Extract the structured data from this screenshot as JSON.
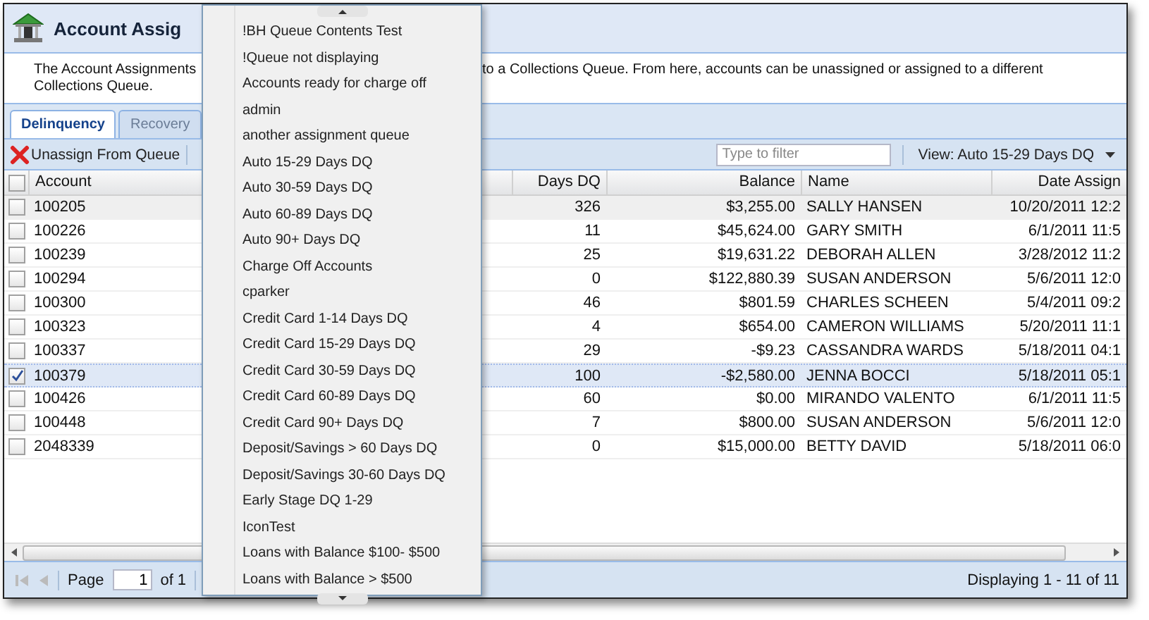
{
  "header": {
    "title": "Account Assig"
  },
  "description": {
    "left": "The Account Assignments",
    "right": "to a Collections Queue. From here, accounts can be unassigned or assigned to a different",
    "line2": "Collections Queue."
  },
  "tabs": [
    {
      "label": "Delinquency",
      "selected": true
    },
    {
      "label": "Recovery",
      "selected": false
    }
  ],
  "toolbar": {
    "unassign_button": "Unassign From Queue",
    "filter": {
      "placeholder": "Type to filter"
    },
    "view_menu": "View: Auto 15-29 Days DQ"
  },
  "table": {
    "all_selected": false,
    "columns": [
      "Account",
      "Days DQ",
      "Balance",
      "Name",
      "Date Assign"
    ],
    "rows": [
      {
        "selected": false,
        "hovered": true,
        "cells": [
          "100205",
          "326",
          "$3,255.00",
          "SALLY HANSEN",
          "10/20/2011 12:2"
        ]
      },
      {
        "selected": false,
        "hovered": false,
        "cells": [
          "100226",
          "11",
          "$45,624.00",
          "GARY SMITH",
          "6/1/2011 11:5"
        ]
      },
      {
        "selected": false,
        "hovered": false,
        "cells": [
          "100239",
          "25",
          "$19,631.22",
          "DEBORAH ALLEN",
          "3/28/2012 11:2"
        ]
      },
      {
        "selected": false,
        "hovered": false,
        "cells": [
          "100294",
          "0",
          "$122,880.39",
          "SUSAN ANDERSON",
          "5/6/2011 12:0"
        ]
      },
      {
        "selected": false,
        "hovered": false,
        "cells": [
          "100300",
          "46",
          "$801.59",
          "CHARLES SCHEEN",
          "5/4/2011 09:2"
        ]
      },
      {
        "selected": false,
        "hovered": false,
        "cells": [
          "100323",
          "4",
          "$654.00",
          "CAMERON WILLIAMS",
          "5/20/2011 11:1"
        ]
      },
      {
        "selected": false,
        "hovered": false,
        "cells": [
          "100337",
          "29",
          "-$9.23",
          "CASSANDRA WARDS",
          "5/18/2011 04:1"
        ]
      },
      {
        "selected": true,
        "hovered": false,
        "cells": [
          "100379",
          "100",
          "-$2,580.00",
          "JENNA BOCCI",
          "5/18/2011 05:1"
        ]
      },
      {
        "selected": false,
        "hovered": false,
        "cells": [
          "100426",
          "60",
          "$0.00",
          "MIRANDO VALENTO",
          "6/1/2011 11:5"
        ]
      },
      {
        "selected": false,
        "hovered": false,
        "cells": [
          "100448",
          "7",
          "$800.00",
          "SUSAN ANDERSON",
          "5/6/2011 12:0"
        ]
      },
      {
        "selected": false,
        "hovered": false,
        "cells": [
          "2048339",
          "0",
          "$15,000.00",
          "BETTY DAVID",
          "5/18/2011 06:0"
        ]
      }
    ]
  },
  "paging": {
    "page_label": "Page",
    "page_value": "1",
    "of_label": "of 1",
    "display": "Displaying 1 - 11 of 11"
  },
  "queue_menu": {
    "items": [
      "!BH Queue Contents Test",
      "!Queue not displaying",
      "Accounts ready for charge off",
      "admin",
      "another assignment queue",
      "Auto 15-29 Days DQ",
      "Auto 30-59 Days DQ",
      "Auto 60-89 Days DQ",
      "Auto 90+ Days DQ",
      "Charge Off Accounts",
      "cparker",
      "Credit Card 1-14 Days DQ",
      "Credit Card 15-29 Days DQ",
      "Credit Card 30-59 Days DQ",
      "Credit Card 60-89 Days DQ",
      "Credit Card 90+ Days DQ",
      "Deposit/Savings > 60 Days DQ",
      "Deposit/Savings 30-60 Days DQ",
      "Early Stage DQ 1-29",
      "IconTest",
      "Loans with Balance $100- $500",
      "Loans with Balance > $500"
    ]
  }
}
